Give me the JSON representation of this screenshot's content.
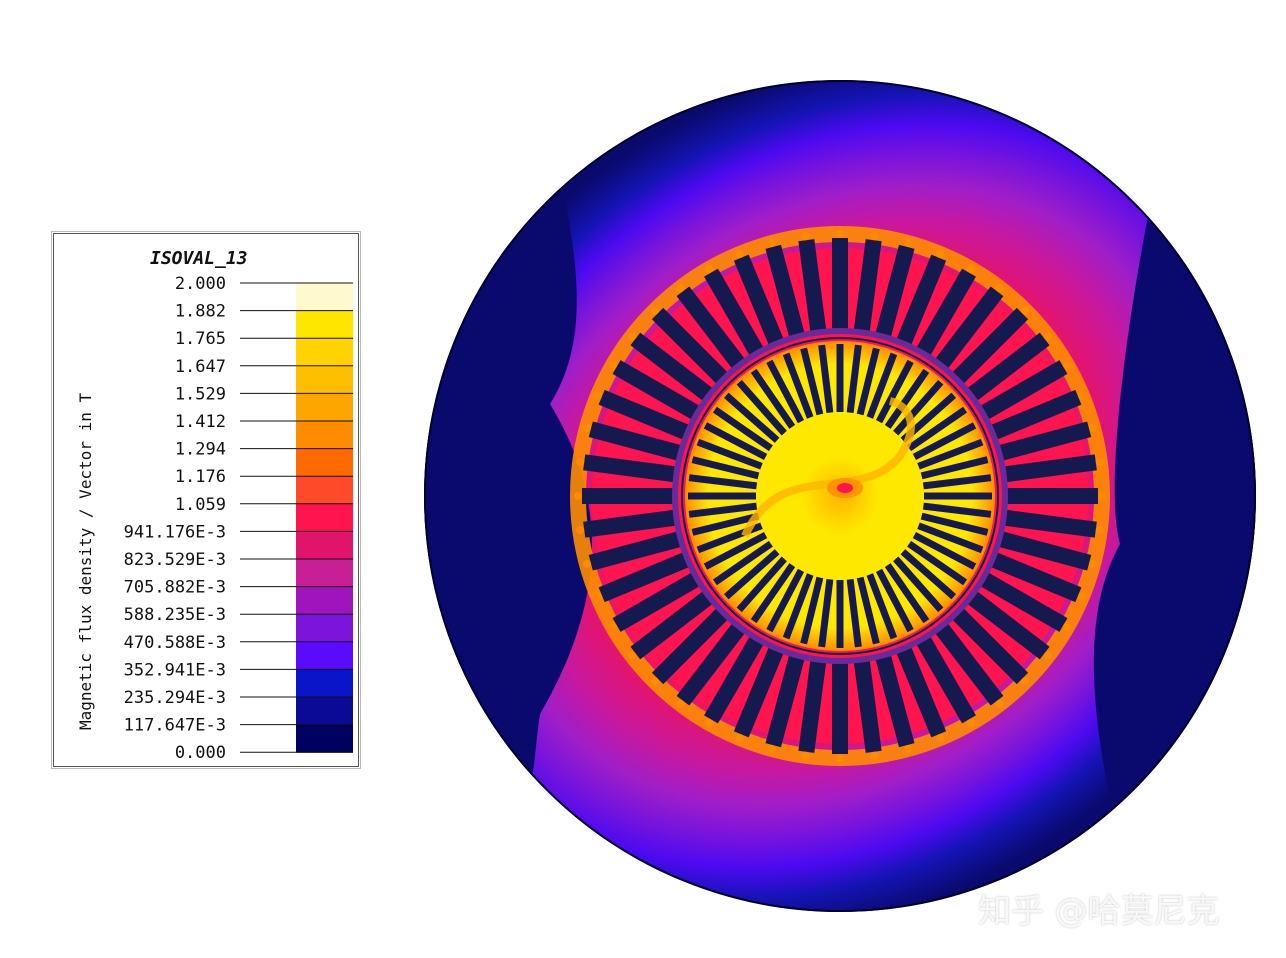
{
  "legend": {
    "title": "ISOVAL_13",
    "quantity": "Magnetic flux density / Vector in T",
    "levels": [
      {
        "label": "2.000",
        "color": "#fffacd"
      },
      {
        "label": "1.882",
        "color": "#ffff00"
      },
      {
        "label": "1.765",
        "color": "#ffe600"
      },
      {
        "label": "1.647",
        "color": "#ffd200"
      },
      {
        "label": "1.529",
        "color": "#ffbe00"
      },
      {
        "label": "1.412",
        "color": "#ffa500"
      },
      {
        "label": "1.294",
        "color": "#ff8c00"
      },
      {
        "label": "1.176",
        "color": "#ff6a00"
      },
      {
        "label": "1.059",
        "color": "#ff4a2a"
      },
      {
        "label": "941.176E-3",
        "color": "#ff1450"
      },
      {
        "label": "823.529E-3",
        "color": "#e0146a"
      },
      {
        "label": "705.882E-3",
        "color": "#c81e96"
      },
      {
        "label": "588.235E-3",
        "color": "#a014be"
      },
      {
        "label": "470.588E-3",
        "color": "#7d14dc"
      },
      {
        "label": "352.941E-3",
        "color": "#5a0aff"
      },
      {
        "label": "235.294E-3",
        "color": "#0a14c8"
      },
      {
        "label": "117.647E-3",
        "color": "#0a0a96"
      },
      {
        "label": "0.000",
        "color": "#000060"
      }
    ]
  },
  "plot": {
    "stator_slots": 48,
    "rotor_bars": 52,
    "colors": {
      "outer": "#0a0a6e",
      "band1": "#1414b4",
      "band2": "#4b0af0",
      "band3": "#7814dc",
      "band4": "#a01ec8",
      "band5": "#c8189e",
      "band6": "#e01474",
      "band7": "#ff1450",
      "hot": "#ff8c00",
      "rotor": "#ffe800",
      "rotor_hot": "#ffb400",
      "slot": "#141a50",
      "ring": "#6a2a9a"
    }
  },
  "watermark": "知乎 @哈莫尼克"
}
